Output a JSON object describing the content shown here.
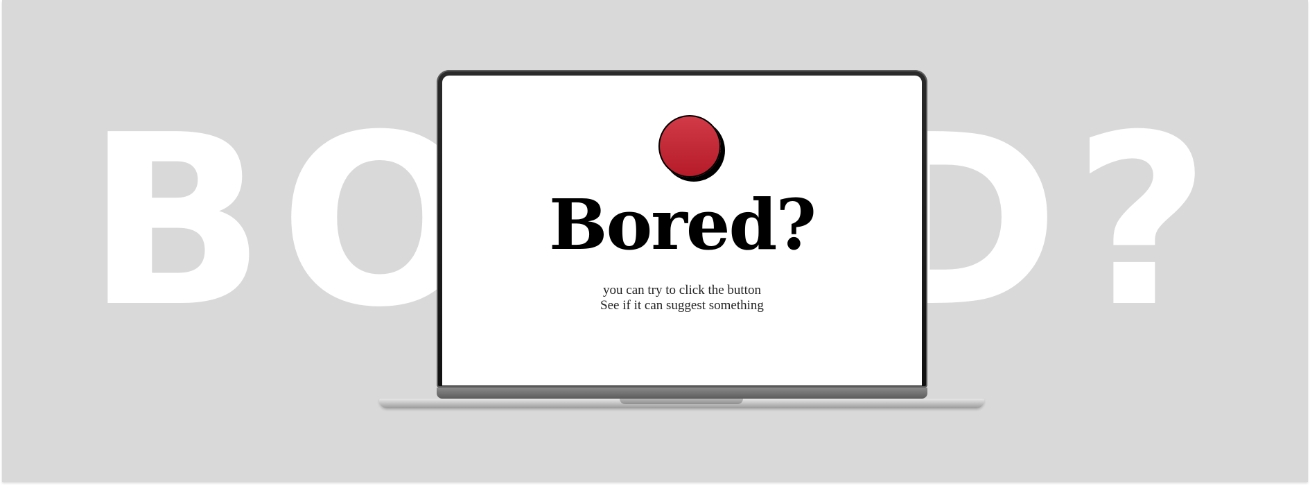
{
  "background": {
    "word": "BORED?",
    "bg_color": "#d9d9d9",
    "word_color": "#ffffff"
  },
  "screen": {
    "button_color": "#c62a36",
    "title": "Bored?",
    "subtitle_line1": "you can try to click the button",
    "subtitle_line2": "See if it can suggest something"
  }
}
